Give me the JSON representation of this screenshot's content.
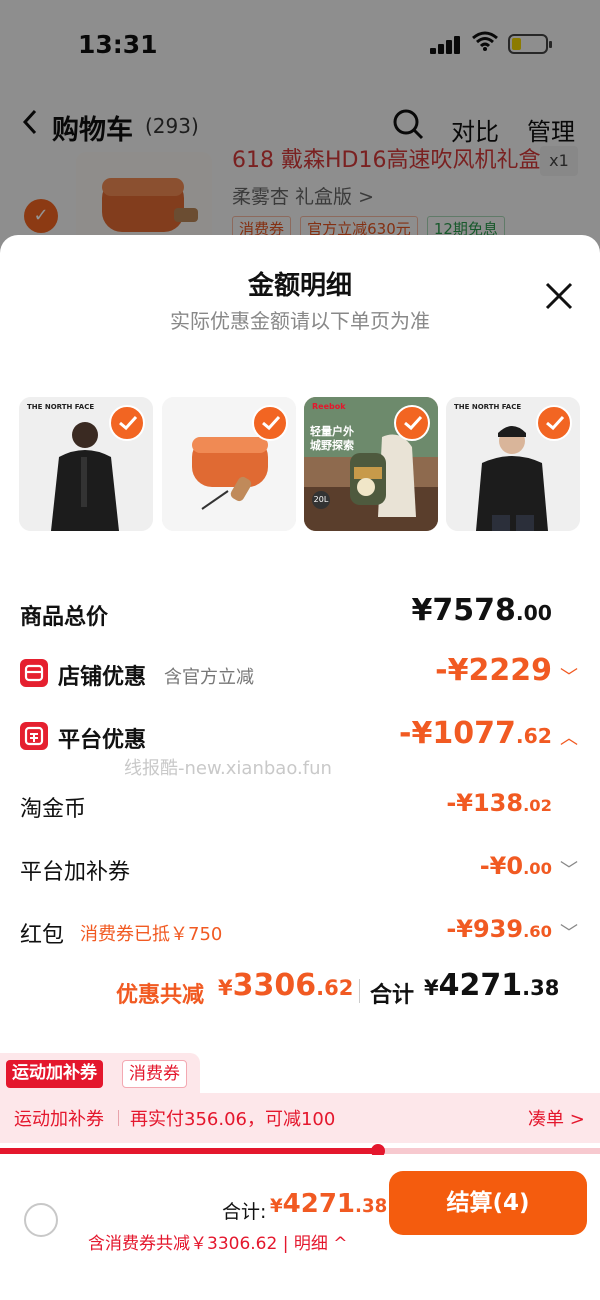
{
  "status_bar": {
    "time": "13:31"
  },
  "nav": {
    "back_icon": "chevron-left-icon",
    "title": "购物车",
    "count": "(293)",
    "search_icon": "search-icon",
    "compare": "对比",
    "manage": "管理"
  },
  "background_item": {
    "name": "618 戴森HD16高速吹风机礼盒",
    "spec": "柔雾杏 礼盒版 >",
    "tags": [
      "消费券",
      "官方立减630元",
      "12期免息"
    ],
    "qty": "x1"
  },
  "sheet": {
    "title": "金额明细",
    "subtitle": "实际优惠金额请以下单页为准",
    "close_icon": "close-icon",
    "thumbnails": [
      {
        "brand": "THE NORTH FACE",
        "name": "black-jacket-woman"
      },
      {
        "brand": "",
        "name": "orange-hair-dryer"
      },
      {
        "brand": "Reebok",
        "name": "outdoor-backpack",
        "caption1": "轻量户外",
        "caption2": "城野探索",
        "volume": "20L"
      },
      {
        "brand": "THE NORTH FACE",
        "name": "black-jacket-man"
      }
    ]
  },
  "breakdown": {
    "goods_total": {
      "label": "商品总价",
      "currency": "¥",
      "int": "7578",
      "dec": ".00"
    },
    "store_discount": {
      "label": "店铺优惠",
      "note": "含官方立减",
      "prefix": "-¥",
      "int": "2229",
      "dec": ""
    },
    "platform_discount": {
      "label": "平台优惠",
      "prefix": "-¥",
      "int": "1077",
      "dec": ".62"
    },
    "tao_coin": {
      "label": "淘金币",
      "prefix": "-¥",
      "int": "138",
      "dec": ".02"
    },
    "platform_coupon": {
      "label": "平台加补券",
      "prefix": "-¥",
      "int": "0",
      "dec": ".00"
    },
    "red_packet": {
      "label": "红包",
      "note": "消费券已抵￥750",
      "prefix": "-¥",
      "int": "939",
      "dec": ".60"
    }
  },
  "watermark": "线报酷-new.xianbao.fun",
  "summary": {
    "discount_label": "优惠共减",
    "discount_prefix": "¥",
    "discount_int": "3306",
    "discount_dec": ".62",
    "total_label": "合计",
    "total_prefix": "¥",
    "total_int": "4271",
    "total_dec": ".38"
  },
  "promo": {
    "tab_active": "运动加补券",
    "tab_inactive": "消费券",
    "name": "运动加补券",
    "message": "再实付356.06，可减100",
    "action": "凑单 >",
    "progress": 0.63
  },
  "bottom": {
    "total_label": "合计:",
    "total_prefix": "¥",
    "total_int": "4271",
    "total_dec": ".38",
    "sub_text": "含消费券共减￥3306.62 | 明细 ^",
    "checkout": "结算(4)"
  },
  "colors": {
    "accent": "#f15a22",
    "red": "#e4172d",
    "checkout": "#f45c0e"
  }
}
